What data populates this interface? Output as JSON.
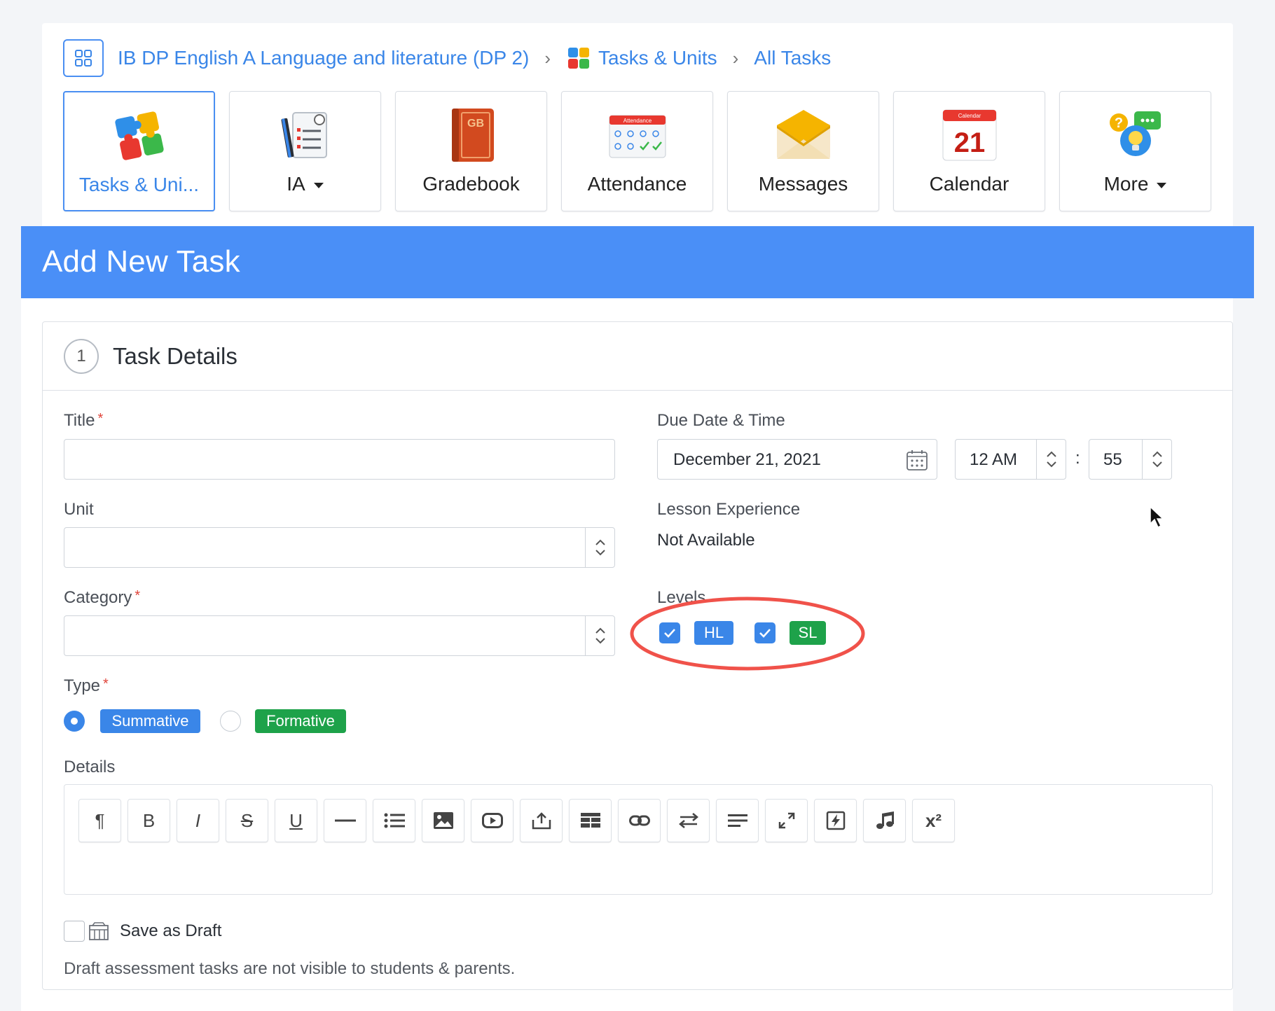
{
  "breadcrumb": {
    "course": "IB DP English A Language and literature (DP 2)",
    "section": "Tasks & Units",
    "page": "All Tasks"
  },
  "nav_tiles": [
    {
      "label": "Tasks & Uni...",
      "icon": "puzzle-icon",
      "active": true
    },
    {
      "label": "IA",
      "icon": "ia-checklist-icon",
      "dropdown": true
    },
    {
      "label": "Gradebook",
      "icon": "gradebook-icon"
    },
    {
      "label": "Attendance",
      "icon": "attendance-icon"
    },
    {
      "label": "Messages",
      "icon": "envelope-icon"
    },
    {
      "label": "Calendar",
      "icon": "calendar-icon"
    },
    {
      "label": "More",
      "icon": "help-chat-icon",
      "dropdown": true
    }
  ],
  "icons_text": {
    "gradebook": "GB",
    "attendance": "Attendance",
    "calendar_header": "Calendar",
    "calendar_day": "21"
  },
  "header": {
    "title": "Add New Task"
  },
  "section": {
    "step": "1",
    "title": "Task Details"
  },
  "form": {
    "title_label": "Title",
    "unit_label": "Unit",
    "category_label": "Category",
    "type_label": "Type",
    "details_label": "Details",
    "due_label": "Due Date & Time",
    "due_date": "December 21, 2021",
    "due_hour": "12 AM",
    "time_sep": ":",
    "due_minute": "55",
    "lesson_label": "Lesson Experience",
    "lesson_value": "Not Available",
    "levels_label": "Levels",
    "level_hl": "HL",
    "level_sl": "SL",
    "type_summative": "Summative",
    "type_formative": "Formative",
    "required_mark": "*",
    "save_draft_label": "Save as Draft",
    "draft_note": "Draft assessment tasks are not visible to students & parents."
  },
  "colors": {
    "accent": "#3a86e8",
    "header_bg": "#4a8ff7",
    "green": "#1ea24a",
    "required": "#e0443a",
    "annotation": "#f0524a"
  },
  "toolbar_glyphs": {
    "paragraph": "¶",
    "bold": "B",
    "italic": "I",
    "strike": "S",
    "underline": "U",
    "superscript": "x²"
  }
}
